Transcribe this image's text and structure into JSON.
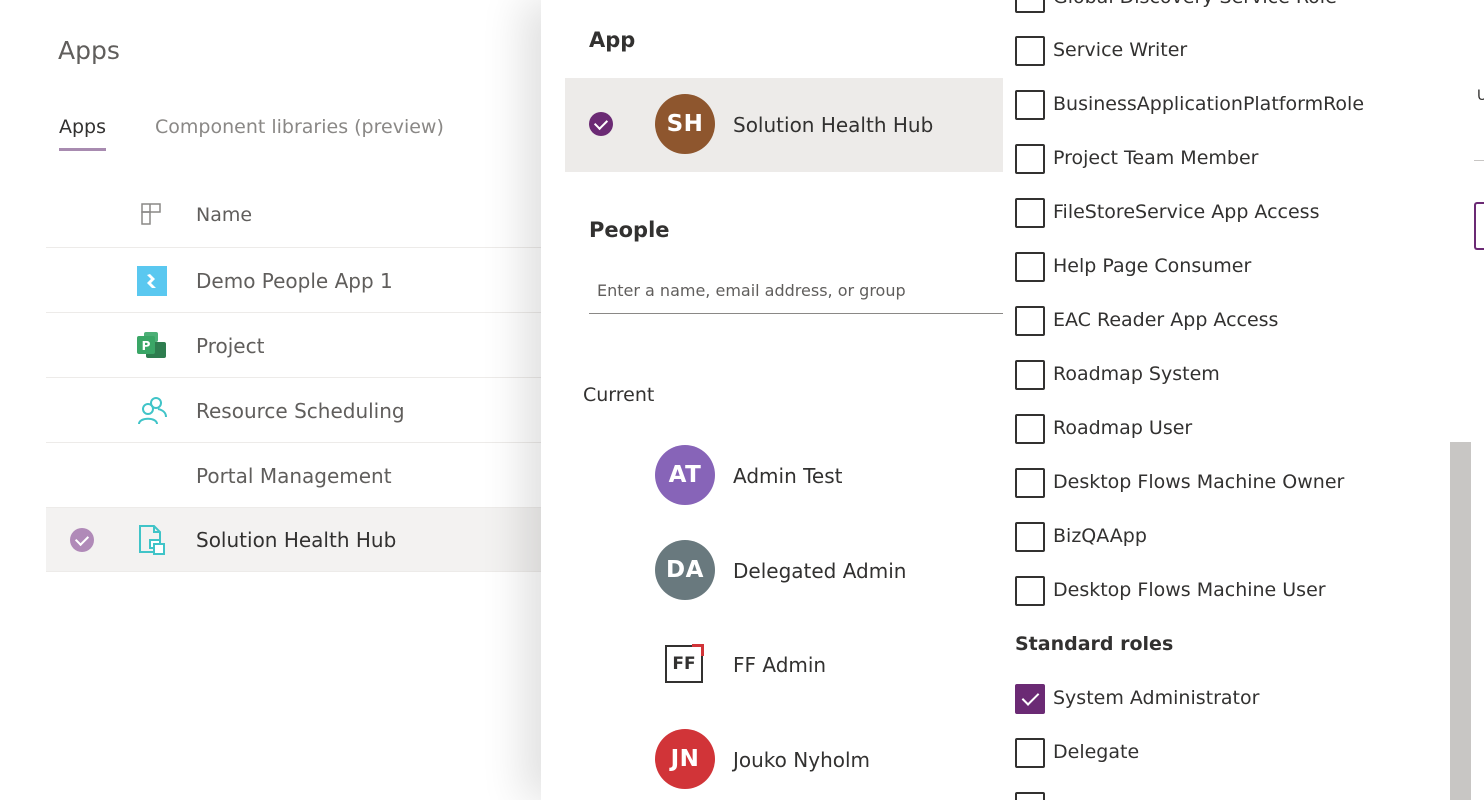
{
  "apps_page": {
    "title": "Apps",
    "tabs": [
      {
        "label": "Apps",
        "active": true
      },
      {
        "label": "Component libraries (preview)",
        "active": false
      }
    ],
    "column_name": "Name",
    "rows": [
      {
        "name": "Demo People App 1",
        "icon": "canvas-app-icon",
        "selected": false
      },
      {
        "name": "Project",
        "icon": "project-icon",
        "selected": false
      },
      {
        "name": "Resource Scheduling",
        "icon": "people-icon",
        "selected": false
      },
      {
        "name": "Portal Management",
        "icon": "",
        "selected": false
      },
      {
        "name": "Solution Health Hub",
        "icon": "model-app-icon",
        "selected": true
      }
    ]
  },
  "share_panel": {
    "app_section_title": "App",
    "app": {
      "initials": "SH",
      "name": "Solution Health Hub",
      "color": "#8e562e"
    },
    "people_section_title": "People",
    "people_input_placeholder": "Enter a name, email address, or group",
    "current_label": "Current",
    "current_people": [
      {
        "initials": "AT",
        "name": "Admin Test",
        "color": "#8764b8"
      },
      {
        "initials": "DA",
        "name": "Delegated Admin",
        "color": "#69797e"
      },
      {
        "initials": "FF",
        "name": "FF Admin",
        "logo": true
      },
      {
        "initials": "JN",
        "name": "Jouko Nyholm",
        "color": "#d13438"
      }
    ]
  },
  "roles_dropdown": {
    "roles": [
      {
        "label": "Global Discovery Service Role",
        "checked": false
      },
      {
        "label": "Service Writer",
        "checked": false
      },
      {
        "label": "BusinessApplicationPlatformRole",
        "checked": false
      },
      {
        "label": "Project Team Member",
        "checked": false
      },
      {
        "label": "FileStoreService App Access",
        "checked": false
      },
      {
        "label": "Help Page Consumer",
        "checked": false
      },
      {
        "label": "EAC Reader App Access",
        "checked": false
      },
      {
        "label": "Roadmap System",
        "checked": false
      },
      {
        "label": "Roadmap User",
        "checked": false
      },
      {
        "label": "Desktop Flows Machine Owner",
        "checked": false
      },
      {
        "label": "BizQAApp",
        "checked": false
      },
      {
        "label": "Desktop Flows Machine User",
        "checked": false
      }
    ],
    "group_header": "Standard roles",
    "standard_roles": [
      {
        "label": "System Administrator",
        "checked": true
      },
      {
        "label": "Delegate",
        "checked": false
      },
      {
        "label": "",
        "checked": false
      }
    ]
  },
  "right_edge": {
    "text": "U"
  },
  "colors": {
    "accent": "#6b2a74",
    "accent_light": "#b08ab8"
  }
}
